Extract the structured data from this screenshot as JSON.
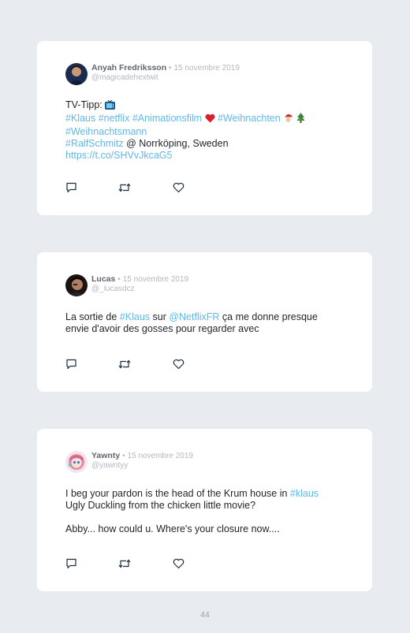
{
  "tweets": [
    {
      "author": "Anyah Fredriksson",
      "separator": "•",
      "date": "15 novembre 2019",
      "handle": "@magicadehextwit",
      "l1_text": "TV-Tipp: ",
      "l2_tag1": "#Klaus",
      "l2_tag2": "#netflix",
      "l2_tag3": "#Animationsfilm",
      "l2_tag4": "#Weihnachten",
      "l3_tag1": "#Weihnachtsmann",
      "l4_tag1": "#RalfSchmitz",
      "l4_text": " @ Norrköping, Sweden",
      "l5_link": "https://t.co/SHVvJkcaG5"
    },
    {
      "author": "Lucas",
      "separator": "•",
      "date": "15 novembre 2019",
      "handle": "@_lucasdcz",
      "l1_text1": "La sortie de ",
      "l1_tag1": "#Klaus",
      "l1_text2": " sur ",
      "l1_mention": "@NetflixFR",
      "l1_text3": " ça me donne presque",
      "l2_text": "envie d'avoir des gosses pour regarder avec"
    },
    {
      "author": "Yawnty",
      "separator": "•",
      "date": "15 novembre 2019",
      "handle": "@yawntyy",
      "l1_text": "I beg your pardon is the head of the Krum house in ",
      "l1_tag": "#klaus",
      "l2_text": "Ugly Duckling from the chicken little movie?",
      "l3_text": "Abby... how could u. Where's your closure now...."
    }
  ],
  "icons": {
    "reply": "reply-icon",
    "retweet": "retweet-icon",
    "like": "like-icon"
  },
  "colors": {
    "page_bg": "#e8ebf0",
    "card_bg": "#ffffff",
    "link": "#60b8e6",
    "text": "#1f2328",
    "muted": "#b2b8c0"
  },
  "page_number": "44"
}
